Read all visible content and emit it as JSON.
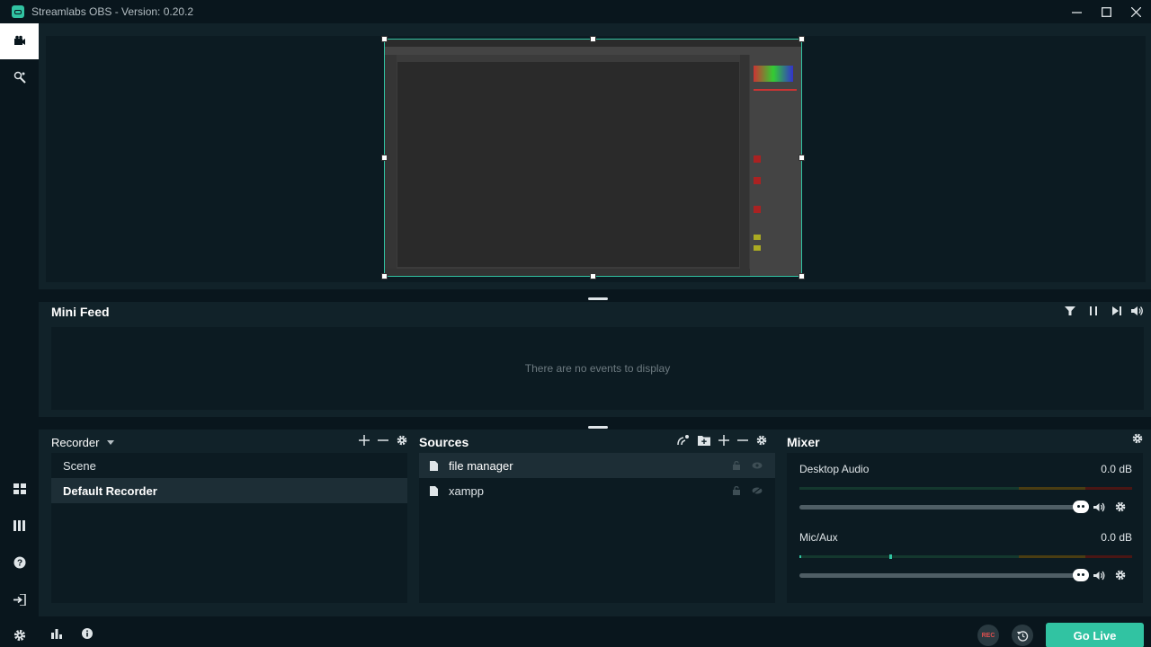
{
  "window": {
    "title": "Streamlabs OBS - Version: 0.20.2",
    "icons": [
      "minimize-icon",
      "maximize-icon",
      "close-icon"
    ]
  },
  "nav": {
    "top_items": [
      "studio-mode-icon",
      "themes-icon"
    ],
    "bottom_items": [
      "layout-icon",
      "library-icon",
      "help-icon",
      "login-icon",
      "settings-icon"
    ]
  },
  "preview": {
    "capture_content": "photoshop-window"
  },
  "minifeed": {
    "title": "Mini Feed",
    "empty_text": "There are no events to display",
    "tools": [
      "filter-icon",
      "pause-icon",
      "skip-icon",
      "volume-icon"
    ]
  },
  "scenes": {
    "collection_label": "Recorder",
    "items": [
      {
        "label": "Scene",
        "selected": false
      },
      {
        "label": "Default Recorder",
        "selected": true
      }
    ]
  },
  "sources": {
    "title": "Sources",
    "items": [
      {
        "label": "file manager",
        "selected": true
      },
      {
        "label": "xampp",
        "selected": false
      }
    ]
  },
  "mixer": {
    "title": "Mixer",
    "channels": [
      {
        "name": "Desktop Audio",
        "level": "0.0 dB"
      },
      {
        "name": "Mic/Aux",
        "level": "0.0 dB"
      }
    ]
  },
  "footer": {
    "rec_label": "REC",
    "golive_label": "Go Live"
  },
  "colors": {
    "accent": "#31c3a2",
    "background": "#09161d",
    "panel": "#112229",
    "rec": "#e04f4f"
  }
}
